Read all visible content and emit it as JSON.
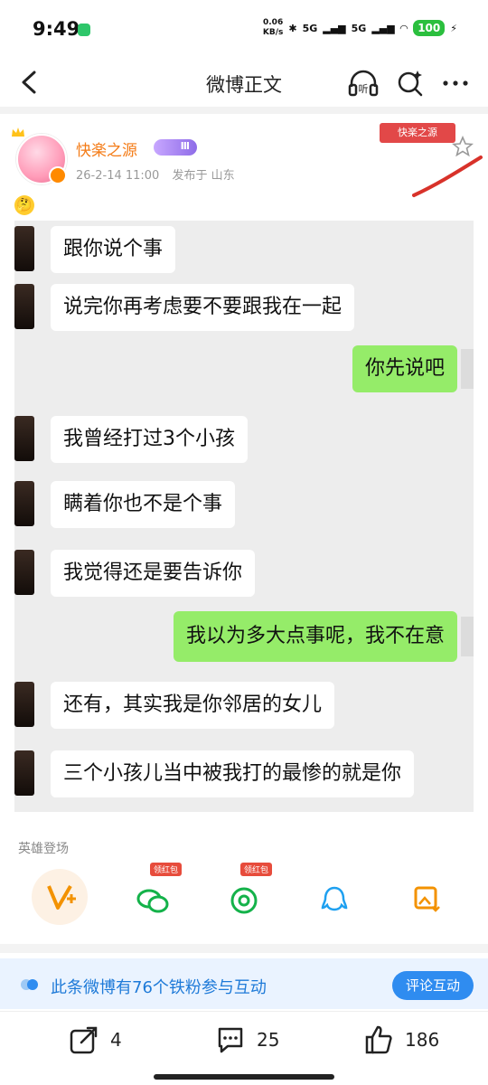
{
  "status_bar": {
    "time": "9:49",
    "speed_value": "0.06",
    "speed_unit": "KB/s",
    "net1": "5G",
    "net2": "5G",
    "battery": "100"
  },
  "nav": {
    "title": "微博正文"
  },
  "post": {
    "username": "快楽之源",
    "level_badge": "Ⅲ",
    "date": "26-2-14 11:00",
    "location": "发布于 山东",
    "fan_tag": "快楽之源",
    "emoji": "🤔"
  },
  "chat": {
    "messages": [
      {
        "side": "left",
        "text": "跟你说个事"
      },
      {
        "side": "left",
        "text": "说完你再考虑要不要跟我在一起"
      },
      {
        "side": "right",
        "text": "你先说吧"
      },
      {
        "side": "left",
        "text": "我曾经打过3个小孩"
      },
      {
        "side": "left",
        "text": "瞒着你也不是个事"
      },
      {
        "side": "left",
        "text": "我觉得还是要告诉你"
      },
      {
        "side": "right",
        "text": "我以为多大点事呢，我不在意"
      },
      {
        "side": "left",
        "text": "还有，其实我是你邻居的女儿"
      },
      {
        "side": "left",
        "text": "三个小孩儿当中被我打的最惨的就是你"
      }
    ]
  },
  "hero": {
    "label": "英雄登场"
  },
  "share_row": {
    "wechat_badge": "领红包",
    "moments_badge": "领红包"
  },
  "iron_fans": {
    "text": "此条微博有76个铁粉参与互动",
    "button": "评论互动"
  },
  "bottom_bar": {
    "repost_count": "4",
    "comment_count": "25",
    "like_count": "186"
  },
  "colors": {
    "accent_orange": "#f47b16",
    "bubble_green": "#95ec69",
    "link_blue": "#1e7ad8"
  }
}
